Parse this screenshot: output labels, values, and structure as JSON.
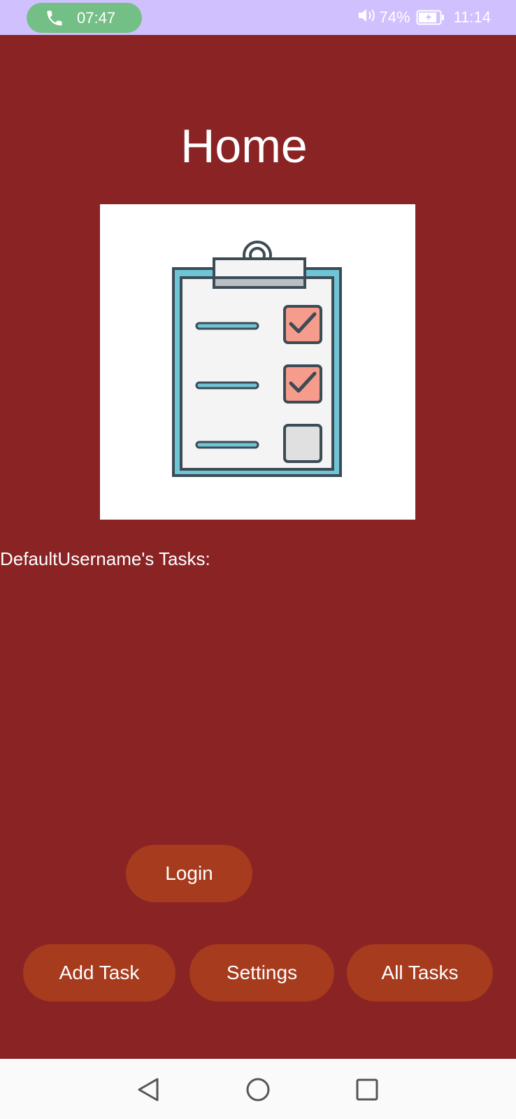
{
  "status_bar": {
    "call_time": "07:47",
    "battery_percent": "74%",
    "clock": "11:14",
    "icons": [
      "phone-icon",
      "volume-icon",
      "battery-charging-icon"
    ]
  },
  "app": {
    "title": "Home",
    "illustration": "clipboard-checklist-icon",
    "tasks_heading": "DefaultUsername's Tasks:",
    "buttons": {
      "login": "Login",
      "add_task": "Add Task",
      "settings": "Settings",
      "all_tasks": "All Tasks"
    }
  },
  "nav_bar": {
    "icons": [
      "back-icon",
      "home-icon",
      "recents-icon"
    ]
  },
  "colors": {
    "status_bar_bg": "#d0c1fe",
    "call_pill": "#74bf85",
    "app_bg": "#8a2324",
    "button_bg": "#a73b1e",
    "nav_bar_bg": "#fafafa"
  }
}
